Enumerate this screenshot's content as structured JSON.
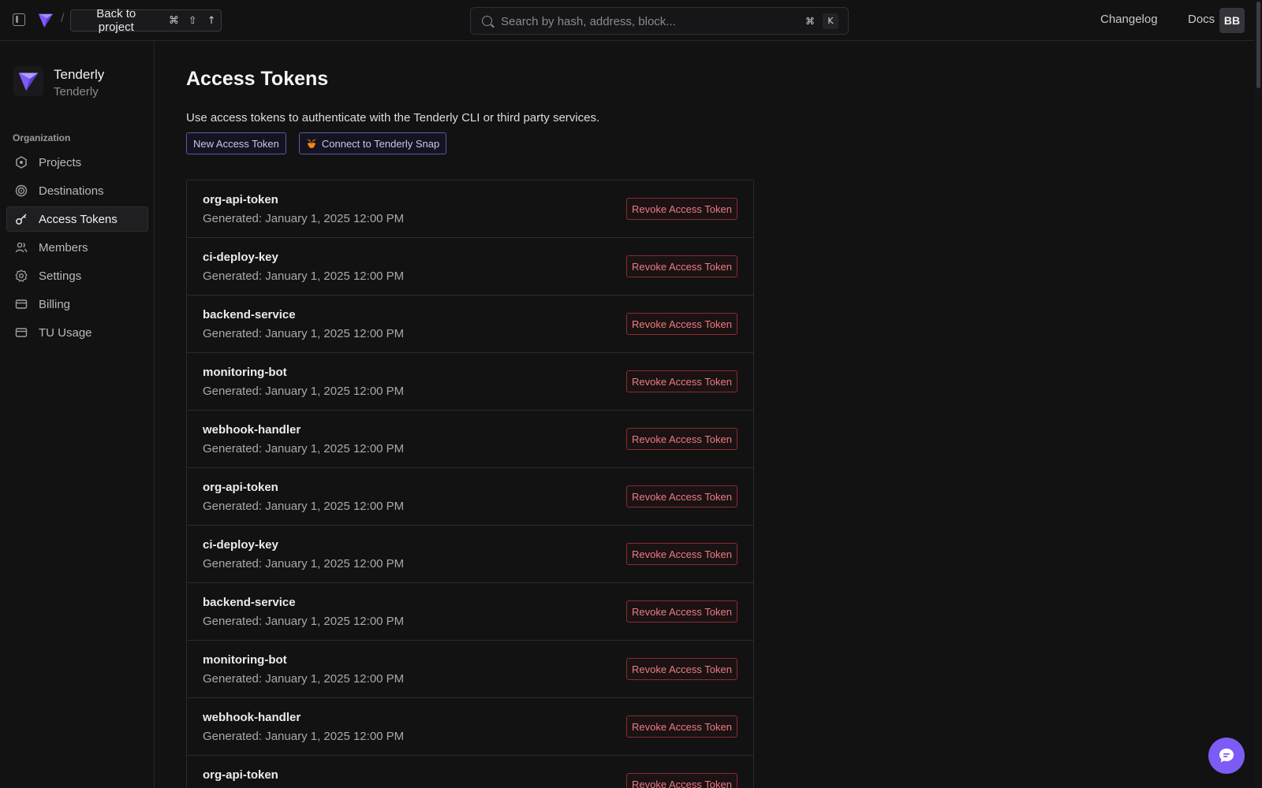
{
  "topbar": {
    "back_label": "Back to project",
    "shortcut_glyphs": [
      "⌘",
      "⇧",
      "↑"
    ],
    "search_placeholder": "Search by hash, address, block...",
    "search_shortcut": [
      "⌘",
      "K"
    ],
    "changelog": "Changelog",
    "docs": "Docs",
    "avatar_initials": "BB"
  },
  "sidebar": {
    "org_name": "Tenderly",
    "org_sub": "Tenderly",
    "section_label": "Organization",
    "items": [
      {
        "label": "Projects",
        "icon": "hexagon-icon"
      },
      {
        "label": "Destinations",
        "icon": "target-icon"
      },
      {
        "label": "Access Tokens",
        "icon": "key-icon",
        "active": true
      },
      {
        "label": "Members",
        "icon": "users-icon"
      },
      {
        "label": "Settings",
        "icon": "gear-icon"
      },
      {
        "label": "Billing",
        "icon": "credit-card-icon"
      },
      {
        "label": "TU Usage",
        "icon": "credit-card-icon"
      }
    ]
  },
  "main": {
    "title": "Access Tokens",
    "description": "Use access tokens to authenticate with the Tenderly CLI or third party services.",
    "new_token_button": "New Access Token",
    "snap_button": "Connect to Tenderly Snap",
    "revoke_label": "Revoke Access Token",
    "tokens": [
      {
        "name": "org-api-token",
        "generated": "Generated: January 1, 2025 12:00 PM"
      },
      {
        "name": "ci-deploy-key",
        "generated": "Generated: January 1, 2025 12:00 PM"
      },
      {
        "name": "backend-service",
        "generated": "Generated: January 1, 2025 12:00 PM"
      },
      {
        "name": "monitoring-bot",
        "generated": "Generated: January 1, 2025 12:00 PM"
      },
      {
        "name": "webhook-handler",
        "generated": "Generated: January 1, 2025 12:00 PM"
      },
      {
        "name": "org-api-token",
        "generated": "Generated: January 1, 2025 12:00 PM"
      },
      {
        "name": "ci-deploy-key",
        "generated": "Generated: January 1, 2025 12:00 PM"
      },
      {
        "name": "backend-service",
        "generated": "Generated: January 1, 2025 12:00 PM"
      },
      {
        "name": "monitoring-bot",
        "generated": "Generated: January 1, 2025 12:00 PM"
      },
      {
        "name": "webhook-handler",
        "generated": "Generated: January 1, 2025 12:00 PM"
      },
      {
        "name": "org-api-token",
        "generated": ""
      }
    ]
  },
  "colors": {
    "background": "#121213",
    "accent": "#7c5cf5",
    "danger": "#f07a82"
  }
}
